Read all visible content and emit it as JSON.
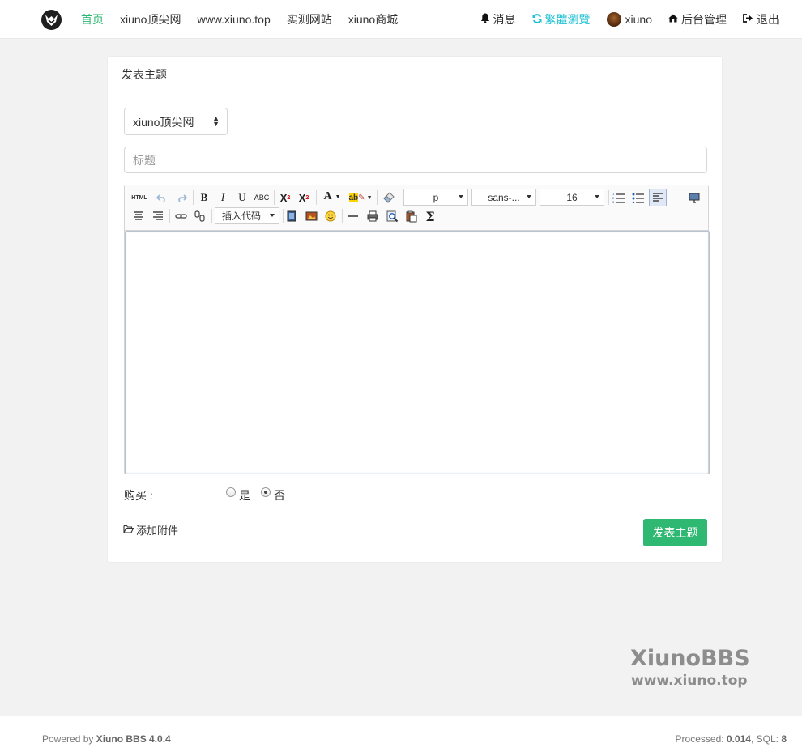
{
  "nav": {
    "logo": "xiuno-logo-icon",
    "items": [
      {
        "label": "首页",
        "active": true
      },
      {
        "label": "xiuno顶尖网"
      },
      {
        "label": "www.xiuno.top"
      },
      {
        "label": "实测网站"
      },
      {
        "label": "xiuno商城"
      }
    ],
    "right": {
      "messages": "消息",
      "traditional": "繁體瀏覽",
      "username": "xiuno",
      "admin": "后台管理",
      "logout": "退出"
    }
  },
  "card": {
    "title": "发表主题",
    "forum_select": {
      "value": "xiuno顶尖网"
    },
    "title_input": {
      "placeholder": "标题",
      "value": ""
    },
    "editor": {
      "html_button": "HTML",
      "paragraph_select": "p",
      "font_select": "sans-...",
      "size_select": "16",
      "code_select": "插入代码",
      "sigma": "Σ",
      "content": ""
    },
    "buy": {
      "label": "购买 :",
      "options": [
        "是",
        "否"
      ],
      "selected": "否"
    },
    "attach_label": "添加附件",
    "submit_label": "发表主题"
  },
  "watermark": {
    "line1": "XiunoBBS",
    "line2": "www.xiuno.top"
  },
  "footer": {
    "powered_prefix": "Powered by ",
    "powered_brand": "Xiuno BBS 4.0.4",
    "processed_label": "Processed: ",
    "processed_value": "0.014",
    "sql_label": ", SQL: ",
    "sql_value": "8"
  },
  "colors": {
    "accent": "#2eb872",
    "cyan_link": "#21c2d3"
  }
}
